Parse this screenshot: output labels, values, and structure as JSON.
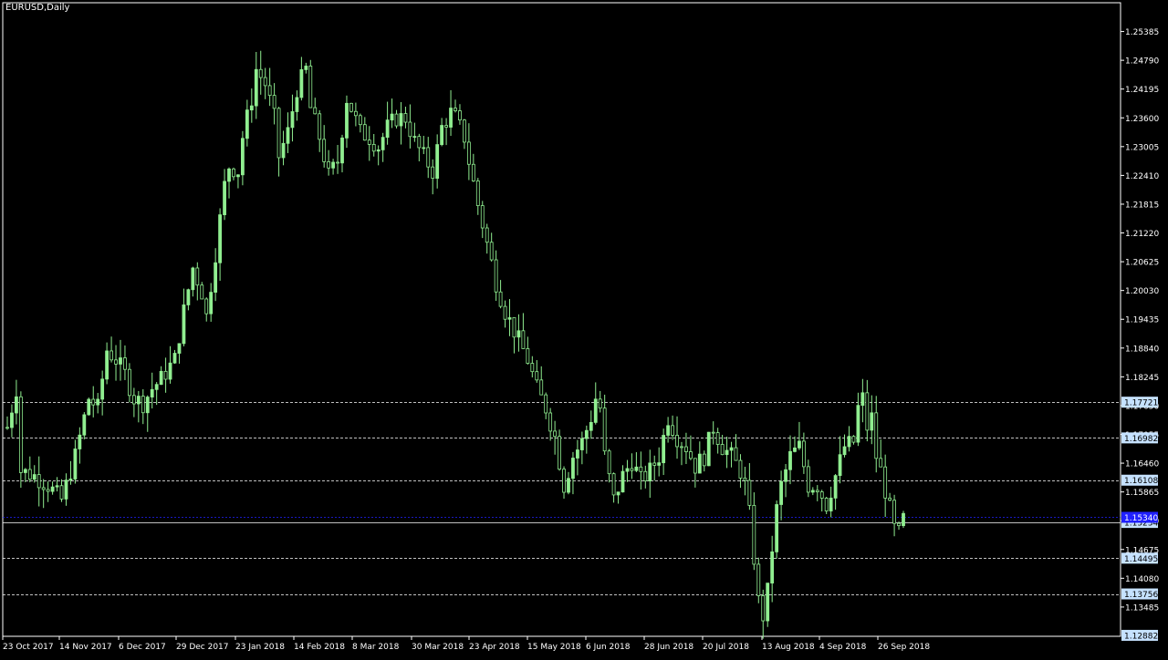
{
  "chart_data": {
    "type": "candlestick",
    "title": "EURUSD,Daily",
    "colors": {
      "background": "#000000",
      "axis": "#ffffff",
      "candle": "#90ee90",
      "level_line": "#ffffff",
      "level_label_bg": "#c6e2ff",
      "current_line": "#2020ff",
      "current_label_bg": "#2020ff"
    },
    "x_tick_labels": [
      "23 Oct 2017",
      "14 Nov 2017",
      "6 Dec 2017",
      "29 Dec 2017",
      "23 Jan 2018",
      "14 Feb 2018",
      "8 Mar 2018",
      "30 Mar 2018",
      "23 Apr 2018",
      "15 May 2018",
      "6 Jun 2018",
      "28 Jun 2018",
      "20 Jul 2018",
      "13 Aug 2018",
      "4 Sep 2018",
      "26 Sep 2018"
    ],
    "y_tick_labels": [
      "1.25385",
      "1.24790",
      "1.24195",
      "1.23600",
      "1.23005",
      "1.22410",
      "1.21815",
      "1.21220",
      "1.20625",
      "1.20030",
      "1.19435",
      "1.18840",
      "1.18245",
      "1.17650",
      "1.17055",
      "1.16460",
      "1.15865",
      "1.15270",
      "1.14675",
      "1.14080",
      "1.13485"
    ],
    "ylim": [
      1.1288,
      1.2598
    ],
    "levels": [
      {
        "value": 1.17721,
        "label": "1.17721",
        "style": "dashed"
      },
      {
        "value": 1.16982,
        "label": "1.16982",
        "style": "dashed"
      },
      {
        "value": 1.16108,
        "label": "1.16108",
        "style": "dashed"
      },
      {
        "value": 1.14495,
        "label": "1.14495",
        "style": "dashed"
      },
      {
        "value": 1.13756,
        "label": "1.13756",
        "style": "dashed"
      },
      {
        "value": 1.15234,
        "label": "1.15234",
        "style": "solid"
      }
    ],
    "current_price": {
      "value": 1.1534,
      "label": "1.15340"
    },
    "bottom_label": "1.12882",
    "close_path": [
      [
        0,
        1.172
      ],
      [
        2,
        1.18
      ],
      [
        3,
        1.163
      ],
      [
        6,
        1.162
      ],
      [
        9,
        1.16
      ],
      [
        12,
        1.157
      ],
      [
        15,
        1.166
      ],
      [
        18,
        1.178
      ],
      [
        20,
        1.176
      ],
      [
        22,
        1.188
      ],
      [
        24,
        1.186
      ],
      [
        26,
        1.183
      ],
      [
        28,
        1.178
      ],
      [
        30,
        1.177
      ],
      [
        32,
        1.18
      ],
      [
        34,
        1.182
      ],
      [
        37,
        1.186
      ],
      [
        39,
        1.196
      ],
      [
        41,
        1.205
      ],
      [
        43,
        1.2
      ],
      [
        44,
        1.195
      ],
      [
        46,
        1.208
      ],
      [
        48,
        1.222
      ],
      [
        49,
        1.226
      ],
      [
        51,
        1.225
      ],
      [
        52,
        1.232
      ],
      [
        54,
        1.24
      ],
      [
        55,
        1.246
      ],
      [
        57,
        1.243
      ],
      [
        59,
        1.236
      ],
      [
        60,
        1.228
      ],
      [
        62,
        1.233
      ],
      [
        64,
        1.242
      ],
      [
        66,
        1.246
      ],
      [
        67,
        1.238
      ],
      [
        69,
        1.232
      ],
      [
        71,
        1.224
      ],
      [
        73,
        1.227
      ],
      [
        75,
        1.24
      ],
      [
        76,
        1.238
      ],
      [
        78,
        1.233
      ],
      [
        80,
        1.232
      ],
      [
        82,
        1.23
      ],
      [
        84,
        1.234
      ],
      [
        86,
        1.236
      ],
      [
        88,
        1.236
      ],
      [
        90,
        1.231
      ],
      [
        92,
        1.228
      ],
      [
        94,
        1.225
      ],
      [
        96,
        1.234
      ],
      [
        98,
        1.237
      ],
      [
        99,
        1.236
      ],
      [
        100,
        1.234
      ],
      [
        101,
        1.232
      ],
      [
        102,
        1.227
      ],
      [
        104,
        1.218
      ],
      [
        106,
        1.21
      ],
      [
        108,
        1.202
      ],
      [
        110,
        1.196
      ],
      [
        112,
        1.192
      ],
      [
        113,
        1.19
      ],
      [
        115,
        1.186
      ],
      [
        117,
        1.18
      ],
      [
        119,
        1.176
      ],
      [
        121,
        1.17
      ],
      [
        123,
        1.16
      ],
      [
        125,
        1.166
      ],
      [
        127,
        1.169
      ],
      [
        129,
        1.174
      ],
      [
        130,
        1.178
      ],
      [
        131,
        1.176
      ],
      [
        132,
        1.166
      ],
      [
        134,
        1.157
      ],
      [
        136,
        1.162
      ],
      [
        138,
        1.165
      ],
      [
        140,
        1.161
      ],
      [
        142,
        1.163
      ],
      [
        144,
        1.166
      ],
      [
        146,
        1.174
      ],
      [
        148,
        1.17
      ],
      [
        150,
        1.168
      ],
      [
        152,
        1.164
      ],
      [
        154,
        1.166
      ],
      [
        156,
        1.172
      ],
      [
        158,
        1.168
      ],
      [
        160,
        1.166
      ],
      [
        162,
        1.163
      ],
      [
        163,
        1.16
      ],
      [
        164,
        1.154
      ],
      [
        165,
        1.145
      ],
      [
        166,
        1.136
      ],
      [
        167,
        1.133
      ],
      [
        168,
        1.138
      ],
      [
        169,
        1.147
      ],
      [
        170,
        1.155
      ],
      [
        171,
        1.16
      ],
      [
        173,
        1.166
      ],
      [
        175,
        1.168
      ],
      [
        177,
        1.16
      ],
      [
        179,
        1.16
      ],
      [
        181,
        1.156
      ],
      [
        183,
        1.162
      ],
      [
        185,
        1.168
      ],
      [
        187,
        1.169
      ],
      [
        188,
        1.176
      ],
      [
        189,
        1.178
      ],
      [
        190,
        1.172
      ],
      [
        191,
        1.174
      ],
      [
        192,
        1.166
      ],
      [
        193,
        1.163
      ],
      [
        195,
        1.155
      ],
      [
        196,
        1.151
      ],
      [
        197,
        1.15
      ],
      [
        198,
        1.153
      ]
    ]
  }
}
